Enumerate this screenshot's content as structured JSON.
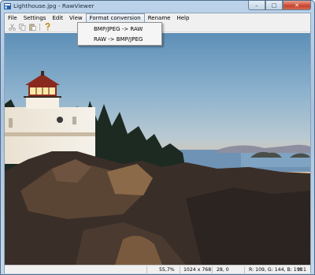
{
  "window": {
    "title": "Lighthouse.jpg - RawViewer",
    "minimize_glyph": "–",
    "maximize_glyph": "□",
    "close_glyph": "✕"
  },
  "menubar": {
    "items": [
      {
        "label": "File"
      },
      {
        "label": "Settings"
      },
      {
        "label": "Edit"
      },
      {
        "label": "View"
      },
      {
        "label": "Format conversion"
      },
      {
        "label": "Rename"
      },
      {
        "label": "Help"
      }
    ],
    "active_index": 4
  },
  "toolbar": {
    "icons": [
      "cut-icon",
      "copy-icon",
      "paste-icon",
      "help-icon"
    ]
  },
  "dropdown": {
    "items": [
      {
        "label": "BMP/JPEG -> RAW"
      },
      {
        "label": "RAW -> BMP/JPEG"
      }
    ]
  },
  "statusbar": {
    "zoom": "55,7%",
    "dimensions": "1024 x 768",
    "coordinates": "28, 0",
    "rgb": "R: 109, G: 144, B: 198",
    "extra": "Y: 1"
  },
  "colors": {
    "accent": "#4f6d8c",
    "close_button": "#c8442c",
    "background": "#f0f0f0"
  }
}
